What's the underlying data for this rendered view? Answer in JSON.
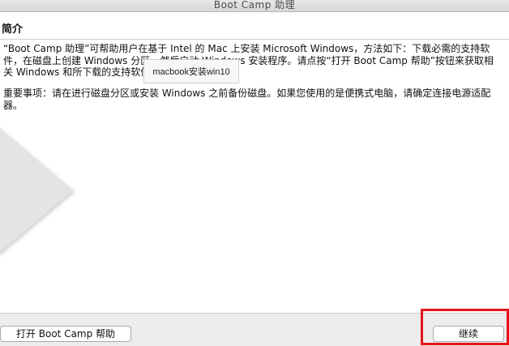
{
  "window": {
    "title": "Boot Camp 助理"
  },
  "content": {
    "heading": "简介",
    "paragraph1": "“Boot Camp 助理”可帮助用户在基于 Intel 的 Mac 上安装 Microsoft Windows，方法如下：下载必需的支持软件，在磁盘上创建 Windows 分区，然后启动 Windows 安装程序。请点按“打开 Boot Camp 帮助”按钮来获取相关 Windows 和所下载的支持软件的安装。",
    "paragraph2": "重要事项：请在进行磁盘分区或安装 Windows 之前备份磁盘。如果您使用的是便携式电脑，请确定连接电源适配器。"
  },
  "overlay": {
    "tooltip_text": "macbook安装win10"
  },
  "buttons": {
    "open_help_label": "打开 Boot Camp 帮助",
    "continue_label": "继续"
  },
  "colors": {
    "highlight": "#e3141a",
    "window_bg": "#ececec",
    "content_bg": "#ffffff"
  }
}
